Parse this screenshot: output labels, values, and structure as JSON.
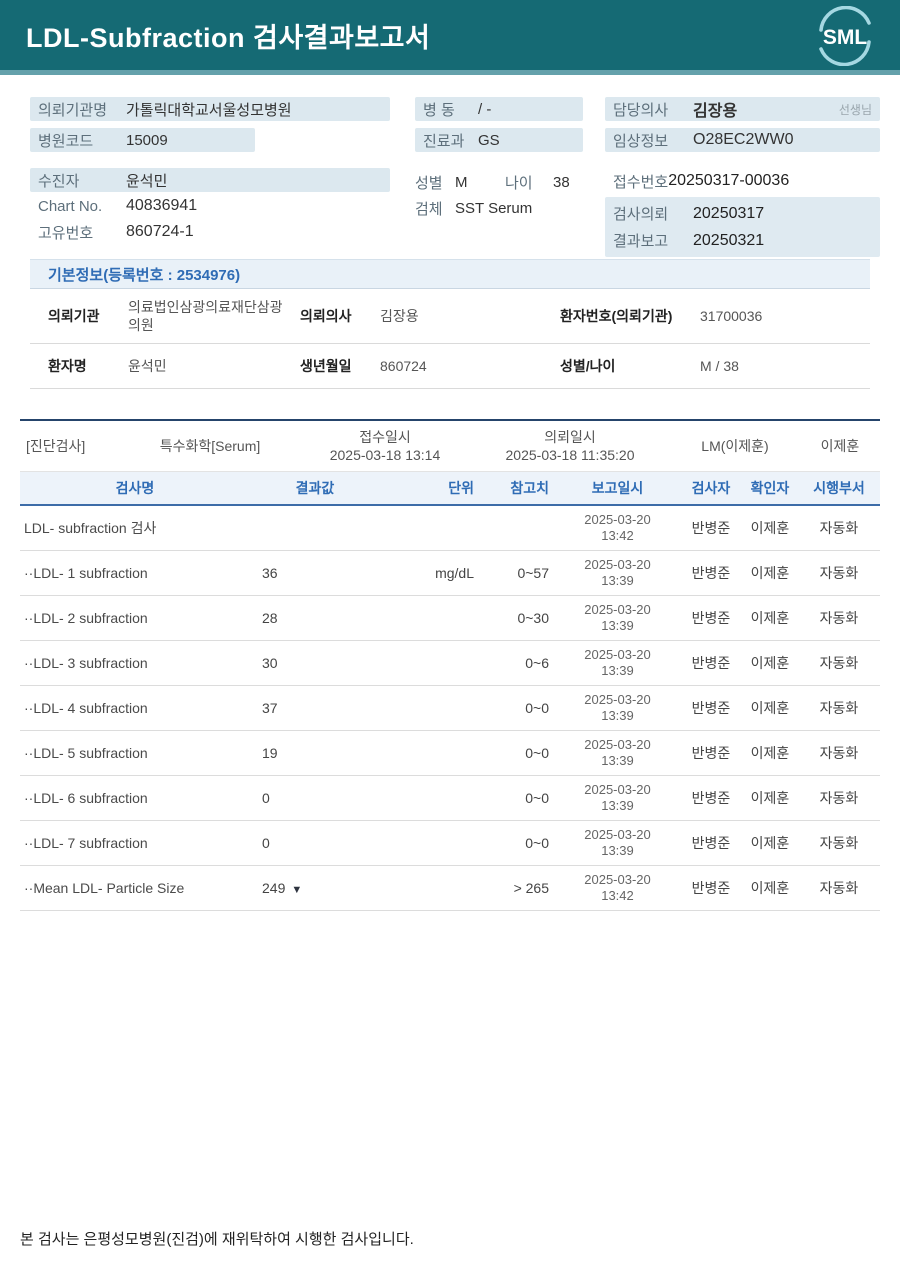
{
  "header": {
    "title": "LDL-Subfraction 검사결과보고서",
    "logo_text": "SML"
  },
  "colors": {
    "header_bg": "#156a74",
    "accent_strip": "#64a1ab",
    "highlight_bg": "#dce8ef",
    "section_blue": "#2f6cb5",
    "table_top_border": "#25446b"
  },
  "info": {
    "org": {
      "label": "의뢰기관명",
      "value": "가톨릭대학교서울성모병원"
    },
    "hospital_code": {
      "label": "병원코드",
      "value": "15009"
    },
    "ward": {
      "label": "병 동",
      "value": "/ -"
    },
    "department": {
      "label": "진료과",
      "value": "GS"
    },
    "doctor": {
      "label": "담당의사",
      "value": "김장용",
      "suffix": "선생님"
    },
    "clinical_info": {
      "label": "임상정보",
      "value": "O28EC2WW0"
    },
    "patient": {
      "label": "수진자",
      "value": "윤석민"
    },
    "chart_no": {
      "label": "Chart No.",
      "value": "40836941"
    },
    "unique_no": {
      "label": "고유번호",
      "value": "860724-1"
    },
    "sex": {
      "label": "성별",
      "value": "M"
    },
    "age": {
      "label": "나이",
      "value": "38"
    },
    "specimen": {
      "label": "검체",
      "value": "SST Serum"
    },
    "receipt_no": {
      "label": "접수번호",
      "value": "20250317-00036"
    },
    "order_date": {
      "label": "검사의뢰",
      "value": "20250317"
    },
    "result_date": {
      "label": "결과보고",
      "value": "20250321"
    }
  },
  "basic_info": {
    "title": "기본정보(등록번호 : 2534976)",
    "rows": [
      [
        {
          "label": "의뢰기관",
          "value": "의료법인삼광의료재단삼광의원"
        },
        {
          "label": "의뢰의사",
          "value": "김장용"
        },
        {
          "label": "환자번호(의뢰기관)",
          "value": "31700036"
        }
      ],
      [
        {
          "label": "환자명",
          "value": "윤석민"
        },
        {
          "label": "생년월일",
          "value": "860724"
        },
        {
          "label": "성별/나이",
          "value": "M / 38"
        }
      ]
    ]
  },
  "report": {
    "meta": {
      "category": "[진단검사]",
      "panel": "특수화학[Serum]",
      "recv_label": "접수일시",
      "recv_value": "2025-03-18 13:14",
      "req_label": "의뢰일시",
      "req_value": "2025-03-18 11:35:20",
      "lm": "LM(이제훈)",
      "approver": "이제훈"
    },
    "columns": [
      "검사명",
      "결과값",
      "단위",
      "참고치",
      "보고일시",
      "검사자",
      "확인자",
      "시행부서"
    ],
    "rows": [
      {
        "name": "LDL- subfraction 검사",
        "result": "",
        "flag": "",
        "unit": "",
        "ref": "",
        "date": "2025-03-20",
        "time": "13:42",
        "tester": "반병준",
        "verifier": "이제훈",
        "dept": "자동화"
      },
      {
        "name": "··LDL- 1 subfraction",
        "result": "36",
        "flag": "",
        "unit": "mg/dL",
        "ref": "0~57",
        "date": "2025-03-20",
        "time": "13:39",
        "tester": "반병준",
        "verifier": "이제훈",
        "dept": "자동화"
      },
      {
        "name": "··LDL- 2 subfraction",
        "result": "28",
        "flag": "",
        "unit": "",
        "ref": "0~30",
        "date": "2025-03-20",
        "time": "13:39",
        "tester": "반병준",
        "verifier": "이제훈",
        "dept": "자동화"
      },
      {
        "name": "··LDL- 3 subfraction",
        "result": "30",
        "flag": "",
        "unit": "",
        "ref": "0~6",
        "date": "2025-03-20",
        "time": "13:39",
        "tester": "반병준",
        "verifier": "이제훈",
        "dept": "자동화"
      },
      {
        "name": "··LDL- 4 subfraction",
        "result": "37",
        "flag": "",
        "unit": "",
        "ref": "0~0",
        "date": "2025-03-20",
        "time": "13:39",
        "tester": "반병준",
        "verifier": "이제훈",
        "dept": "자동화"
      },
      {
        "name": "··LDL- 5 subfraction",
        "result": "19",
        "flag": "",
        "unit": "",
        "ref": "0~0",
        "date": "2025-03-20",
        "time": "13:39",
        "tester": "반병준",
        "verifier": "이제훈",
        "dept": "자동화"
      },
      {
        "name": "··LDL- 6 subfraction",
        "result": "0",
        "flag": "",
        "unit": "",
        "ref": "0~0",
        "date": "2025-03-20",
        "time": "13:39",
        "tester": "반병준",
        "verifier": "이제훈",
        "dept": "자동화"
      },
      {
        "name": "··LDL- 7 subfraction",
        "result": "0",
        "flag": "",
        "unit": "",
        "ref": "0~0",
        "date": "2025-03-20",
        "time": "13:39",
        "tester": "반병준",
        "verifier": "이제훈",
        "dept": "자동화"
      },
      {
        "name": "··Mean LDL- Particle Size",
        "result": "249",
        "flag": "▼",
        "unit": "",
        "ref": "> 265",
        "date": "2025-03-20",
        "time": "13:42",
        "tester": "반병준",
        "verifier": "이제훈",
        "dept": "자동화"
      }
    ]
  },
  "footer": {
    "note": "본 검사는 은평성모병원(진검)에 재위탁하여 시행한 검사입니다."
  }
}
